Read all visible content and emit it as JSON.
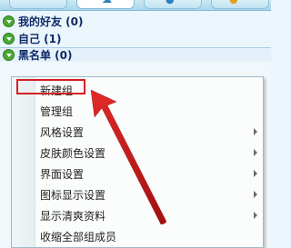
{
  "groups": [
    {
      "label": "我的好友 (0)"
    },
    {
      "label": "自己 (1)"
    },
    {
      "label": "黑名单 (0)"
    }
  ],
  "context_menu": {
    "items": [
      {
        "label": "新建组",
        "has_submenu": false
      },
      {
        "label": "管理组",
        "has_submenu": false
      },
      {
        "label": "风格设置",
        "has_submenu": true
      },
      {
        "label": "皮肤颜色设置",
        "has_submenu": true
      },
      {
        "label": "界面设置",
        "has_submenu": true
      },
      {
        "label": "图标显示设置",
        "has_submenu": true
      },
      {
        "label": "显示清爽资料",
        "has_submenu": true
      },
      {
        "label": "收缩全部组成员",
        "has_submenu": false
      }
    ]
  },
  "annotation": {
    "color": "#d62020"
  },
  "theme": {
    "group_icon": "#4aa832",
    "group_text": "#0f2a66"
  }
}
